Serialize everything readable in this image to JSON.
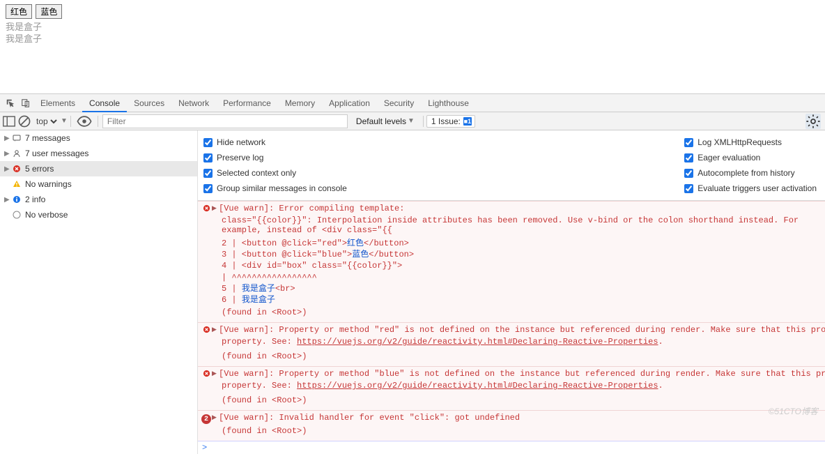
{
  "page": {
    "btn_red": "红色",
    "btn_blue": "蓝色",
    "box_line1": "我是盒子",
    "box_line2": "我是盒子"
  },
  "devtools_tabs": [
    "Elements",
    "Console",
    "Sources",
    "Network",
    "Performance",
    "Memory",
    "Application",
    "Security",
    "Lighthouse"
  ],
  "toolbar": {
    "context": "top",
    "filter_placeholder": "Filter",
    "levels_label": "Default levels",
    "issue_label": "1 Issue:",
    "issue_count": "1"
  },
  "sidebar": [
    {
      "icon": "msg",
      "label": "7 messages",
      "arrow": true
    },
    {
      "icon": "user",
      "label": "7 user messages",
      "arrow": true
    },
    {
      "icon": "error",
      "label": "5 errors",
      "arrow": true,
      "selected": true
    },
    {
      "icon": "warn",
      "label": "No warnings",
      "arrow": false
    },
    {
      "icon": "info",
      "label": "2 info",
      "arrow": true
    },
    {
      "icon": "verbose",
      "label": "No verbose",
      "arrow": false
    }
  ],
  "settings": {
    "left": [
      "Hide network",
      "Preserve log",
      "Selected context only",
      "Group similar messages in console"
    ],
    "right": [
      "Log XMLHttpRequests",
      "Eager evaluation",
      "Autocomplete from history",
      "Evaluate triggers user activation"
    ]
  },
  "console": {
    "err1_head": "[Vue warn]: Error compiling template:",
    "err1_desc": "class=\"{{color}}\": Interpolation inside attributes has been removed. Use v-bind or the colon shorthand instead. For example, instead of <div class=\"{{",
    "code": {
      "l2a": "2  |       <button @click=\"red\">",
      "l2z": "红色",
      "l2b": "</button>",
      "l3a": "3  |       <button @click=\"blue\">",
      "l3z": "蓝色",
      "l3b": "</button>",
      "l4": "4  |       <div id=\"box\" class=\"{{color}}\">",
      "car": "   |                      ^^^^^^^^^^^^^^^^^",
      "l5a": "5  |           ",
      "l5z": "我是盒子",
      "l5b": "<br>",
      "l6a": "6  |           ",
      "l6z": "我是盒子"
    },
    "found": "(found in <Root>)",
    "err2a": "[Vue warn]: Property or method \"red\" is not defined on the instance but referenced during render. Make sure that this property is reactive, either i",
    "err2b": "property. See: ",
    "err_link": "https://vuejs.org/v2/guide/reactivity.html#Declaring-Reactive-Properties",
    "err2c": ".",
    "err3a": "[Vue warn]: Property or method \"blue\" is not defined on the instance but referenced during render. Make sure that this property is reactive, either ",
    "err4": "[Vue warn]: Invalid handler for event \"click\": got undefined",
    "badge2": "2",
    "prompt": ">"
  },
  "watermark": "©51CTO博客"
}
